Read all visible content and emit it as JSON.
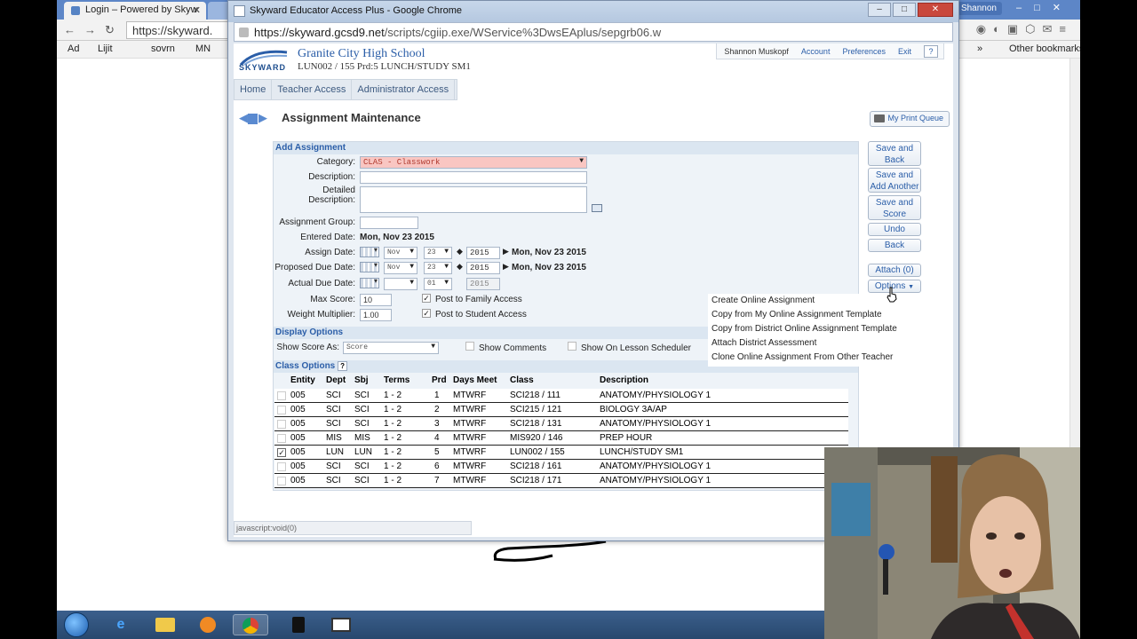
{
  "browser_bg": {
    "tab_title": "Login – Powered by Skyw",
    "omnibox": "https://skyward.",
    "profile": "Shannon",
    "bookmarks": [
      "Ad",
      "Lijit",
      "sovrn",
      "MN",
      "»",
      "Other bookmarks"
    ]
  },
  "popup": {
    "window_title": "Skyward Educator Access Plus - Google Chrome",
    "url_host": "https://skyward.gcsd9.net",
    "url_path": "/scripts/cgiip.exe/WService%3DwsEAplus/sepgrb06.w"
  },
  "header": {
    "logo_text": "SKYWARD",
    "school": "Granite City High School",
    "course": "LUN002 / 155 Prd:5 LUNCH/STUDY SM1",
    "user": "Shannon Muskopf",
    "links": [
      "Account",
      "Preferences",
      "Exit"
    ],
    "help": "?"
  },
  "nav": [
    "Home",
    "Teacher Access",
    "Administrator Access"
  ],
  "page_title": "Assignment Maintenance",
  "print_queue": "My Print Queue",
  "form": {
    "section_add": "Add Assignment",
    "category_label": "Category:",
    "category_value": "CLAS - Classwork",
    "description_label": "Description:",
    "detailed_label": "Detailed Description:",
    "group_label": "Assignment Group:",
    "entered_label": "Entered Date:",
    "entered_value": "Mon, Nov 23 2015",
    "assign_label": "Assign Date:",
    "assign_month": "Nov",
    "assign_day": "23",
    "assign_year": "2015",
    "assign_text": "Mon, Nov 23 2015",
    "due_label": "Proposed Due Date:",
    "due_month": "Nov",
    "due_day": "23",
    "due_year": "2015",
    "due_text": "Mon, Nov 23 2015",
    "actual_label": "Actual Due Date:",
    "actual_day": "01",
    "actual_year": "2015",
    "max_label": "Max Score:",
    "max_value": "10",
    "weight_label": "Weight Multiplier:",
    "weight_value": "1.00",
    "post_family": "Post to Family Access",
    "post_student": "Post to Student Access",
    "section_display": "Display Options",
    "show_score_label": "Show Score As:",
    "show_score_value": "Score",
    "show_comments": "Show Comments",
    "show_lesson": "Show On Lesson Scheduler",
    "section_class": "Class Options",
    "class_help": "?"
  },
  "class_table": {
    "headers": [
      "Entity",
      "Dept",
      "Sbj",
      "Terms",
      "Prd",
      "Days Meet",
      "Class",
      "Description"
    ],
    "rows": [
      {
        "checked": false,
        "entity": "005",
        "dept": "SCI",
        "sbj": "SCI",
        "terms": "1 - 2",
        "prd": "1",
        "days": "MTWRF",
        "class": "SCI218 / 111",
        "desc": "ANATOMY/PHYSIOLOGY 1"
      },
      {
        "checked": false,
        "entity": "005",
        "dept": "SCI",
        "sbj": "SCI",
        "terms": "1 - 2",
        "prd": "2",
        "days": "MTWRF",
        "class": "SCI215 / 121",
        "desc": "BIOLOGY 3A/AP"
      },
      {
        "checked": false,
        "entity": "005",
        "dept": "SCI",
        "sbj": "SCI",
        "terms": "1 - 2",
        "prd": "3",
        "days": "MTWRF",
        "class": "SCI218 / 131",
        "desc": "ANATOMY/PHYSIOLOGY 1"
      },
      {
        "checked": false,
        "entity": "005",
        "dept": "MIS",
        "sbj": "MIS",
        "terms": "1 - 2",
        "prd": "4",
        "days": "MTWRF",
        "class": "MIS920 / 146",
        "desc": "PREP HOUR"
      },
      {
        "checked": true,
        "entity": "005",
        "dept": "LUN",
        "sbj": "LUN",
        "terms": "1 - 2",
        "prd": "5",
        "days": "MTWRF",
        "class": "LUN002 / 155",
        "desc": "LUNCH/STUDY SM1"
      },
      {
        "checked": false,
        "entity": "005",
        "dept": "SCI",
        "sbj": "SCI",
        "terms": "1 - 2",
        "prd": "6",
        "days": "MTWRF",
        "class": "SCI218 / 161",
        "desc": "ANATOMY/PHYSIOLOGY 1"
      },
      {
        "checked": false,
        "entity": "005",
        "dept": "SCI",
        "sbj": "SCI",
        "terms": "1 - 2",
        "prd": "7",
        "days": "MTWRF",
        "class": "SCI218 / 171",
        "desc": "ANATOMY/PHYSIOLOGY 1"
      }
    ]
  },
  "buttons": {
    "save_back": "Save and Back",
    "save_another": "Save and Add Another",
    "save_score": "Save and Score",
    "undo": "Undo",
    "back": "Back",
    "attach": "Attach (0)",
    "options": "Options"
  },
  "options_menu": [
    "Create Online Assignment",
    "Copy from My Online Assignment Template",
    "Copy from District Online Assignment Template",
    "Attach District Assessment",
    "Clone Online Assignment From Other Teacher"
  ],
  "status_text": "javascript:void(0)",
  "colors": {
    "accent": "#2b5ea8",
    "category_bg": "#f9c6c2",
    "panel_bg": "#eef3f8"
  }
}
